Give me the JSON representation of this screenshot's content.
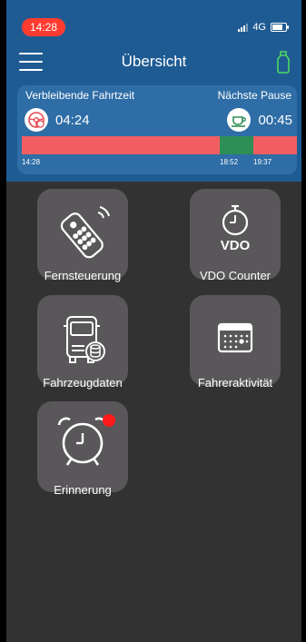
{
  "status_bar": {
    "time": "14:28",
    "network": "4G"
  },
  "header": {
    "title": "Übersicht"
  },
  "driving": {
    "remaining_label": "Verbleibende Fahrtzeit",
    "remaining_value": "04:24",
    "next_break_label": "Nächste Pause",
    "next_break_value": "00:45",
    "timeline": {
      "start": "14:28",
      "break_start": "18:52",
      "break_end": "19:37"
    }
  },
  "tiles": [
    {
      "label": "Fernsteuerung",
      "icon": "remote-control-icon"
    },
    {
      "label": "VDO Counter",
      "icon": "vdo-counter-icon",
      "logo_text": "VDO"
    },
    {
      "label": "Fahrzeugdaten",
      "icon": "truck-data-icon"
    },
    {
      "label": "Fahreraktivität",
      "icon": "calendar-icon"
    },
    {
      "label": "Erinnerung",
      "icon": "alarm-clock-icon",
      "notification": true
    }
  ],
  "colors": {
    "header_bg": "#1f5b93",
    "card_bg": "#2e6da6",
    "drive_segment": "#f15e62",
    "break_segment": "#2e8e55",
    "background": "#333233",
    "tile_bg": "#595759",
    "status_pill": "#ff3b30",
    "notification_badge": "#ff1a1a",
    "device_connected": "#4cd964"
  }
}
